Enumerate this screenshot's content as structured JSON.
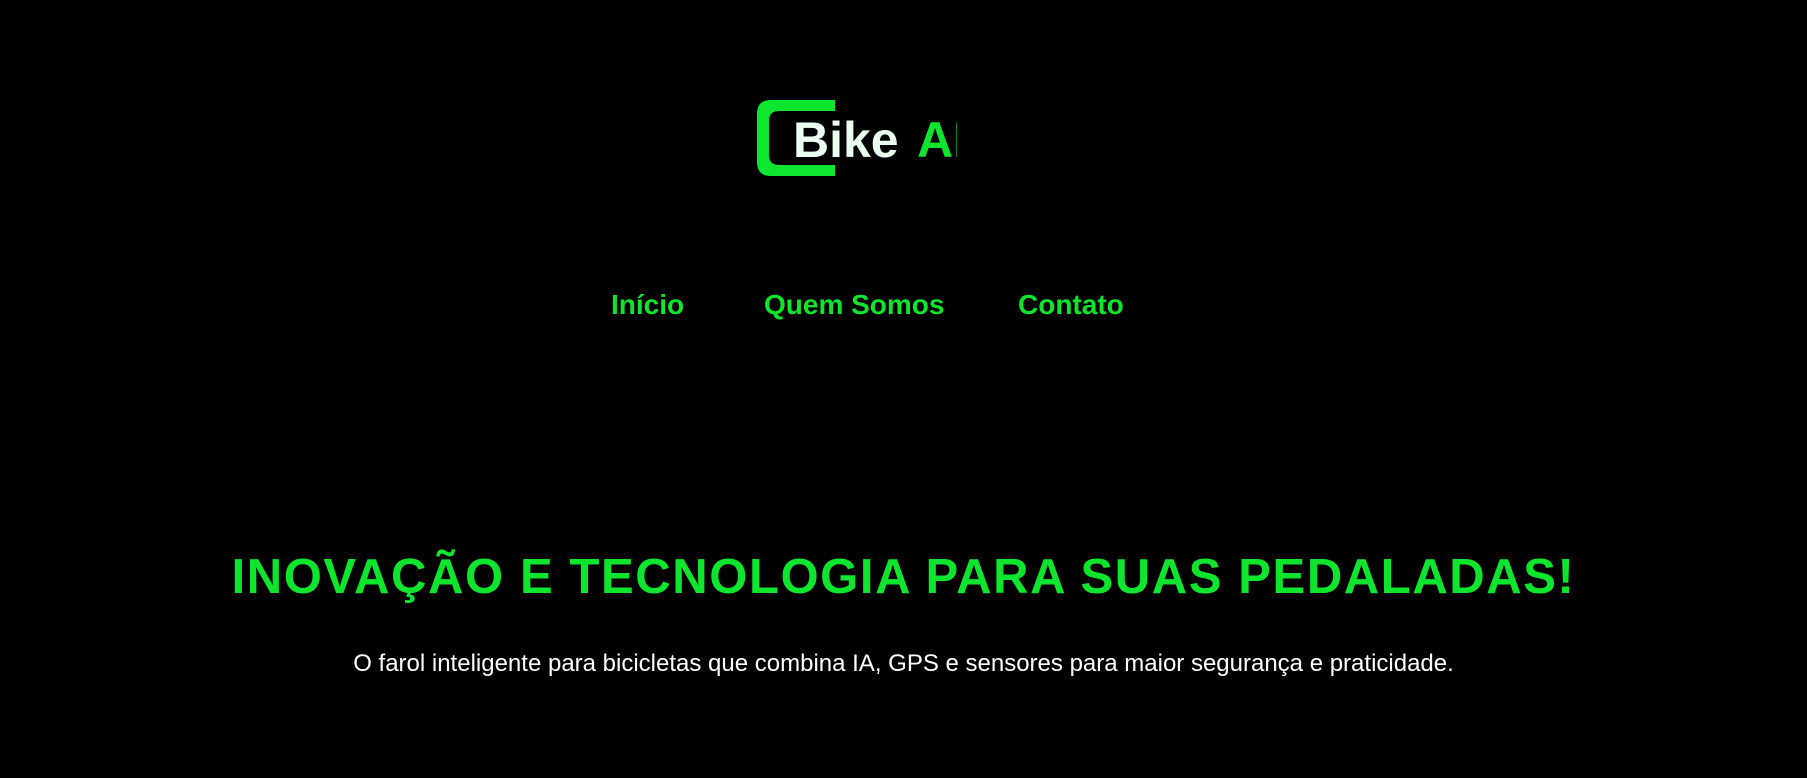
{
  "brand": {
    "logo_text_main": "Bike",
    "logo_text_accent": "AI",
    "logo_icon": "bracket-logo-icon",
    "colors": {
      "accent": "#0ee62e",
      "text_light": "#eafff0",
      "background": "#000000"
    }
  },
  "nav": {
    "items": [
      {
        "label": "Início"
      },
      {
        "label": "Quem Somos"
      },
      {
        "label": "Contato"
      }
    ]
  },
  "hero": {
    "title": "INOVAÇÃO E TECNOLOGIA PARA SUAS PEDALADAS!",
    "subtitle": "O farol inteligente para bicicletas que combina IA, GPS e sensores para maior segurança e praticidade."
  }
}
